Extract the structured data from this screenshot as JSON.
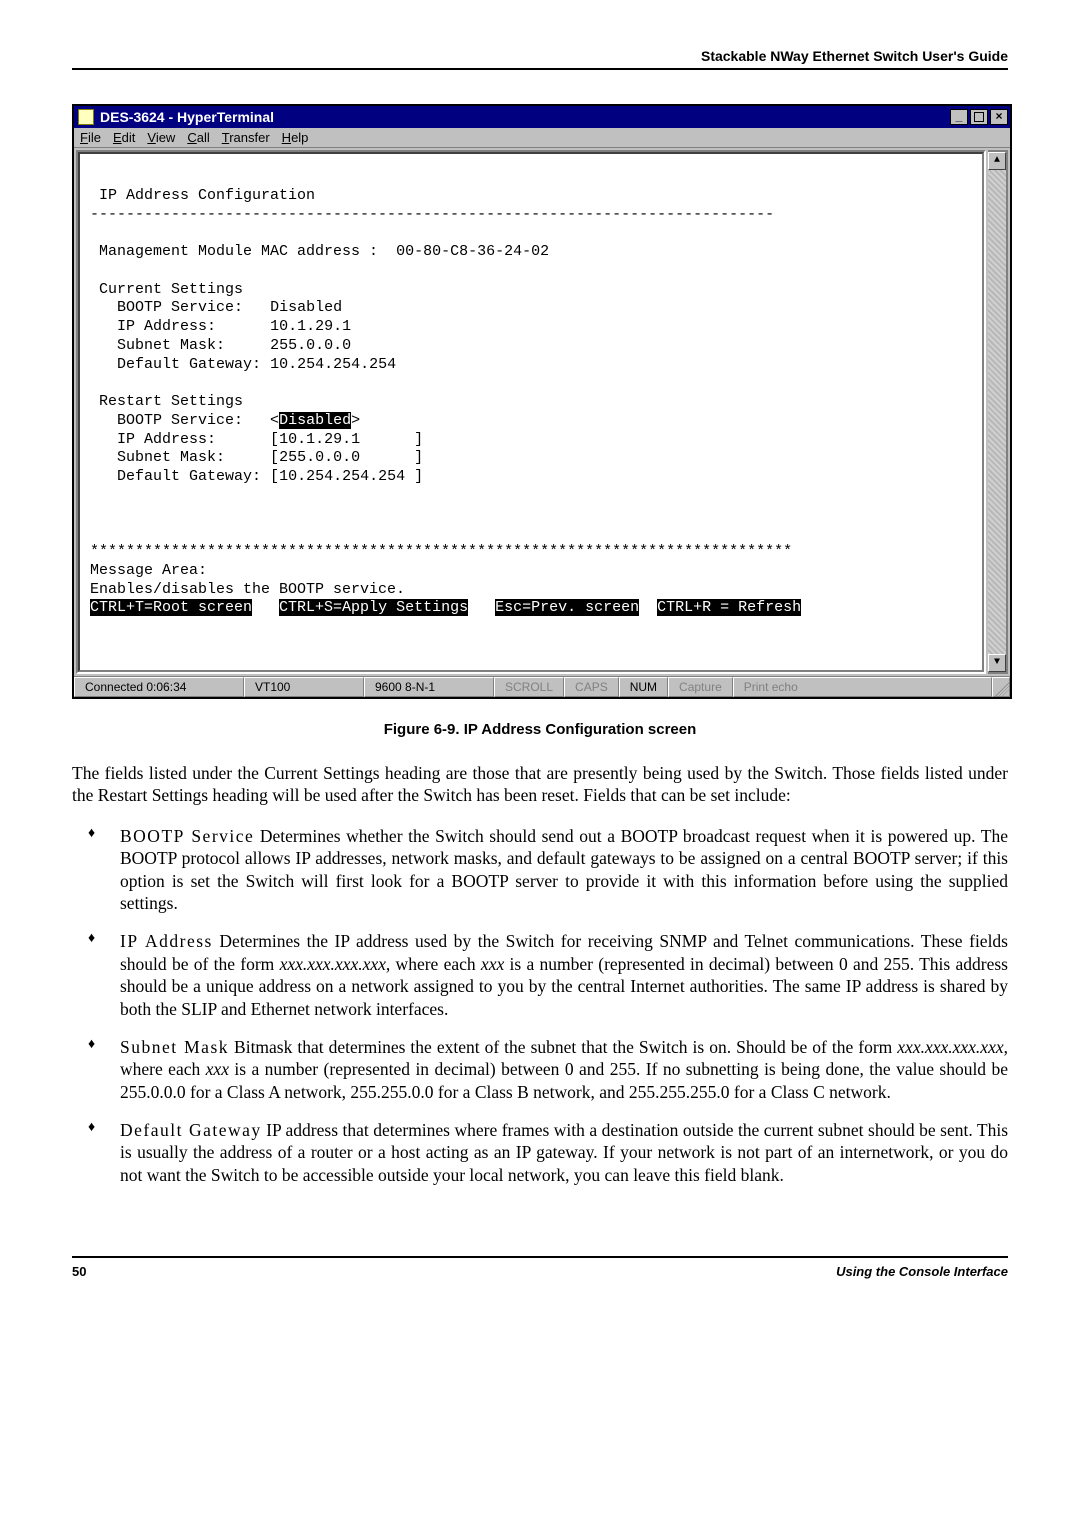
{
  "header": {
    "running": "Stackable NWay Ethernet Switch User's Guide"
  },
  "window": {
    "title": "DES-3624 - HyperTerminal",
    "ctrl_min": "_",
    "ctrl_close": "×",
    "menu": {
      "file": "File",
      "edit": "Edit",
      "view": "View",
      "call": "Call",
      "transfer": "Transfer",
      "help": "Help"
    }
  },
  "terminal": {
    "title": "IP Address Configuration",
    "rule": "----------------------------------------------------------------------------",
    "mac_label": "Management Module MAC address :",
    "mac_value": "00-80-C8-36-24-02",
    "current_heading": "Current Settings",
    "current": {
      "bootp_label": "BOOTP Service:",
      "bootp_value": "Disabled",
      "ip_label": "IP Address:",
      "ip_value": "10.1.29.1",
      "mask_label": "Subnet Mask:",
      "mask_value": "255.0.0.0",
      "gw_label": "Default Gateway:",
      "gw_value": "10.254.254.254"
    },
    "restart_heading": "Restart Settings",
    "restart": {
      "bootp_label": "BOOTP Service:",
      "bootp_value": "Disabled",
      "ip_label": "IP Address:",
      "ip_value": "10.1.29.1",
      "mask_label": "Subnet Mask:",
      "mask_value": "255.0.0.0",
      "gw_label": "Default Gateway:",
      "gw_value": "10.254.254.254"
    },
    "stars": "******************************************************************************",
    "msg_area": "Message Area:",
    "msg_text": "Enables/disables the BOOTP service.",
    "hotkeys": {
      "root": "CTRL+T=Root screen",
      "apply": "CTRL+S=Apply Settings",
      "prev": "Esc=Prev. screen",
      "refresh": "CTRL+R = Refresh"
    }
  },
  "status": {
    "connected": "Connected 0:06:34",
    "emul": "VT100",
    "params": "9600 8-N-1",
    "scroll": "SCROLL",
    "caps": "CAPS",
    "num": "NUM",
    "capture": "Capture",
    "printecho": "Print echo"
  },
  "figure": {
    "caption": "Figure 6-9.  IP Address Configuration screen"
  },
  "body": {
    "intro": "The fields listed under the Current Settings heading are those that are presently being used by the Switch. Those fields listed under the Restart Settings heading will be used after the Switch has been reset. Fields that can be set include:",
    "items": [
      {
        "term": "BOOTP Service",
        "text": "  Determines whether the Switch should send out a BOOTP broadcast request when it is powered up. The BOOTP protocol allows IP addresses, network masks, and default gateways to be assigned on a central BOOTP server; if this option is set the Switch will first look for a BOOTP server to provide it with this information before using the supplied settings."
      },
      {
        "term": "IP Address",
        "text_a": "   Determines the IP address used by the Switch for receiving SNMP and Telnet communications. These fields should be of the form ",
        "ital1": "xxx.xxx.xxx.xxx",
        "text_b": ", where each ",
        "ital2": "xxx",
        "text_c": " is a number (represented in decimal) between 0 and 255. This address should be a unique address on a network assigned to you by the central Internet authorities. The same IP address is shared by both the SLIP and Ethernet network interfaces."
      },
      {
        "term": "Subnet Mask",
        "text_a": "  Bitmask that determines the extent of the subnet that the Switch is on. Should be of the form ",
        "ital1": "xxx.xxx.xxx.xxx",
        "text_b": ", where each ",
        "ital2": "xxx",
        "text_c": " is a number (represented in decimal) between 0 and 255. If no subnetting is being done, the value should be 255.0.0.0 for a Class A network, 255.255.0.0 for a Class B network, and 255.255.255.0 for a Class C network."
      },
      {
        "term": "Default Gateway",
        "text": "  IP address that determines where frames with a destination outside the current subnet should be sent. This is usually the address of a router or a host acting as an IP gateway. If your network is not part of an internetwork, or you do not want the Switch to be accessible outside your local network, you can leave this field blank."
      }
    ]
  },
  "footer": {
    "page": "50",
    "section": "Using the Console Interface"
  }
}
